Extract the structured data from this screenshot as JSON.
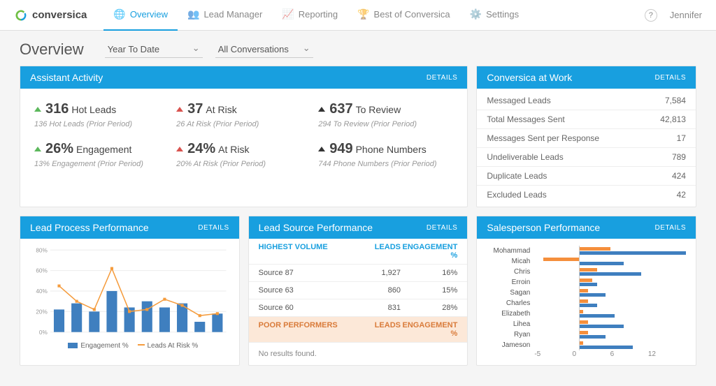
{
  "logo_text": "conversica",
  "nav": [
    {
      "label": "Overview",
      "active": true
    },
    {
      "label": "Lead Manager"
    },
    {
      "label": "Reporting"
    },
    {
      "label": "Best of Conversica"
    },
    {
      "label": "Settings"
    }
  ],
  "user": "Jennifer",
  "page_title": "Overview",
  "filter_period": "Year To Date",
  "filter_conv": "All Conversations",
  "cards": {
    "assistant": {
      "title": "Assistant Activity",
      "details": "DETAILS"
    },
    "work": {
      "title": "Conversica at Work",
      "details": "DETAILS"
    },
    "leadprocess": {
      "title": "Lead Process Performance",
      "details": "DETAILS"
    },
    "leadsource": {
      "title": "Lead Source Performance",
      "details": "DETAILS"
    },
    "salesperson": {
      "title": "Salesperson Performance",
      "details": "DETAILS"
    }
  },
  "metrics": [
    {
      "num": "316",
      "lbl": "Hot Leads",
      "prior": "136 Hot Leads (Prior Period)",
      "tri": "g"
    },
    {
      "num": "37",
      "lbl": "At Risk",
      "prior": "26 At Risk (Prior Period)",
      "tri": "r"
    },
    {
      "num": "637",
      "lbl": "To Review",
      "prior": "294 To Review (Prior Period)",
      "tri": "k"
    },
    {
      "num": "26%",
      "lbl": "Engagement",
      "prior": "13% Engagement (Prior Period)",
      "tri": "g"
    },
    {
      "num": "24%",
      "lbl": "At Risk",
      "prior": "20% At Risk (Prior Period)",
      "tri": "r"
    },
    {
      "num": "949",
      "lbl": "Phone Numbers",
      "prior": "744 Phone Numbers (Prior Period)",
      "tri": "k"
    }
  ],
  "work_rows": [
    {
      "k": "Messaged Leads",
      "v": "7,584"
    },
    {
      "k": "Total Messages Sent",
      "v": "42,813"
    },
    {
      "k": "Messages Sent per Response",
      "v": "17"
    },
    {
      "k": "Undeliverable Leads",
      "v": "789"
    },
    {
      "k": "Duplicate Leads",
      "v": "424"
    },
    {
      "k": "Excluded Leads",
      "v": "42"
    }
  ],
  "leadsource": {
    "hdr_hv": "HIGHEST VOLUME",
    "hdr_leads": "LEADS",
    "hdr_eng": "ENGAGEMENT %",
    "rows": [
      {
        "src": "Source 87",
        "leads": "1,927",
        "eng": "16%"
      },
      {
        "src": "Source 63",
        "leads": "860",
        "eng": "15%"
      },
      {
        "src": "Source 60",
        "leads": "831",
        "eng": "28%"
      }
    ],
    "poor_hdr": "POOR PERFORMERS",
    "poor_leads": "LEADS",
    "poor_eng": "ENGAGEMENT %",
    "noresult": "No results found."
  },
  "chart_data": [
    {
      "type": "bar+line",
      "title": "Lead Process Performance",
      "ylabel": "%",
      "ylim": [
        0,
        80
      ],
      "series": [
        {
          "name": "Engagement %",
          "type": "bar",
          "values": [
            22,
            28,
            20,
            40,
            24,
            30,
            24,
            28,
            10,
            18
          ]
        },
        {
          "name": "Leads At Risk %",
          "type": "line",
          "values": [
            45,
            30,
            22,
            62,
            20,
            22,
            32,
            26,
            16,
            18
          ]
        }
      ],
      "categories": [
        "",
        "",
        "",
        "",
        "",
        "",
        "",
        "",
        "",
        ""
      ]
    },
    {
      "type": "bar-horizontal",
      "title": "Salesperson Performance",
      "xlim": [
        -5,
        12
      ],
      "categories": [
        "Mohammad",
        "Micah",
        "Chris",
        "Erroin",
        "Sagan",
        "Charles",
        "Elizabeth",
        "Lihea",
        "Ryan",
        "Jameson"
      ],
      "series": [
        {
          "name": "orange",
          "values": [
            3.5,
            -4,
            2,
            1.5,
            1,
            1,
            0.5,
            1,
            1,
            0.5
          ]
        },
        {
          "name": "blue",
          "values": [
            12,
            5,
            7,
            2,
            3,
            2,
            4,
            5,
            3,
            6
          ]
        }
      ]
    }
  ],
  "lp_legend": {
    "a": "Engagement %",
    "b": "Leads At Risk %"
  },
  "sp_axis": [
    "-5",
    "0",
    "6",
    "12"
  ]
}
